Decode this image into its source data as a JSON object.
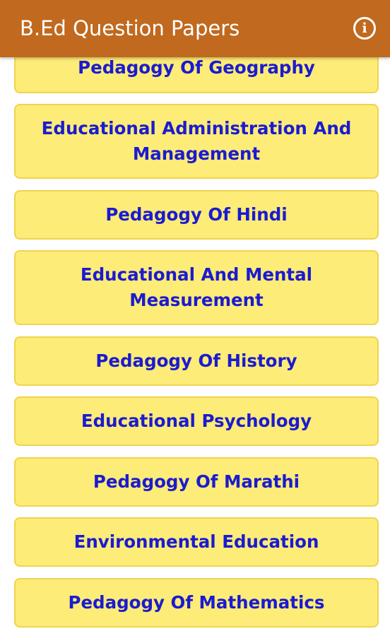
{
  "appbar": {
    "title": "B.Ed Question Papers",
    "info_icon": "info-icon",
    "info_glyph": "i",
    "background_color": "#c0691f"
  },
  "subjects": [
    {
      "label": "Pedagogy Of Geography"
    },
    {
      "label": "Educational Administration And Management"
    },
    {
      "label": "Pedagogy Of Hindi"
    },
    {
      "label": "Educational And Mental Measurement"
    },
    {
      "label": "Pedagogy Of History"
    },
    {
      "label": "Educational Psychology"
    },
    {
      "label": "Pedagogy Of Marathi"
    },
    {
      "label": "Environmental Education"
    },
    {
      "label": "Pedagogy Of Mathematics"
    }
  ],
  "colors": {
    "card_background": "#fdec77",
    "card_border": "#f1d34d",
    "card_text": "#1b1bd0"
  }
}
